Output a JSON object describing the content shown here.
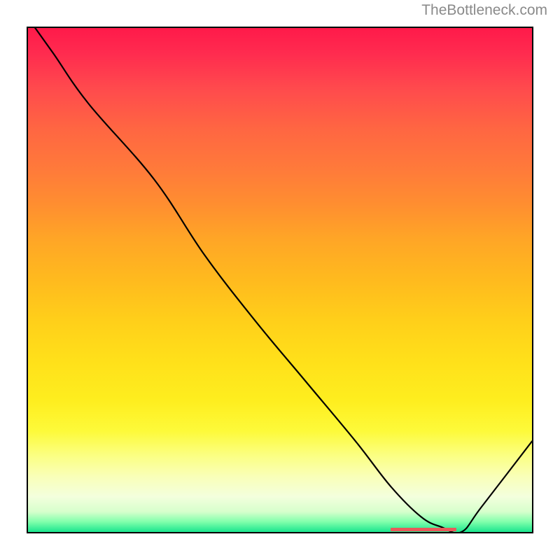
{
  "watermark": "TheBottleneck.com",
  "chart_data": {
    "type": "line",
    "title": "",
    "xlabel": "",
    "ylabel": "",
    "xlim": [
      0,
      100
    ],
    "ylim": [
      0,
      100
    ],
    "x": [
      0,
      5,
      12,
      25,
      35,
      45,
      55,
      65,
      72,
      78,
      82,
      86,
      90,
      100
    ],
    "y": [
      102,
      95,
      85,
      70,
      55,
      42,
      30,
      18,
      9,
      3,
      1,
      0,
      5,
      18
    ],
    "annotations": [
      {
        "type": "segment",
        "x_start": 72,
        "x_end": 85,
        "y": 0.5,
        "color": "#e85a5a"
      }
    ]
  }
}
